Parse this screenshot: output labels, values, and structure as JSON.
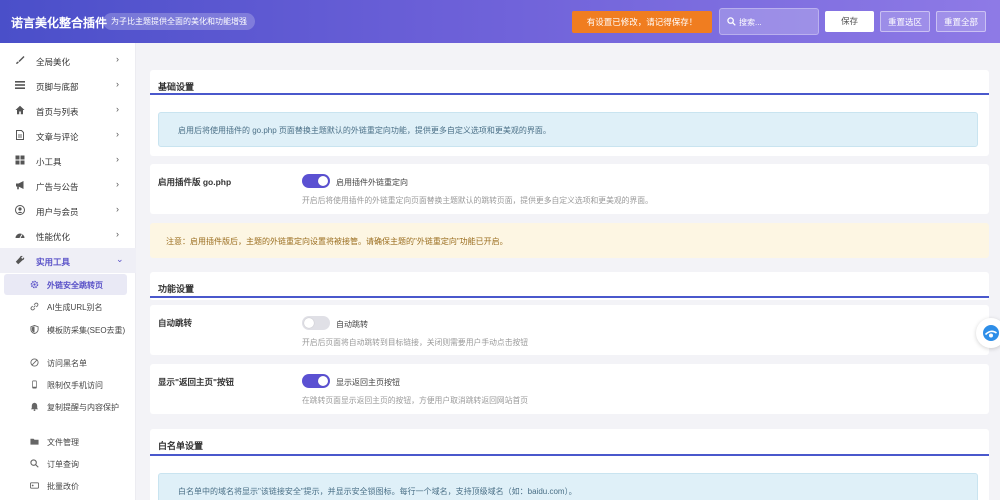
{
  "header": {
    "brand": "诺言美化整合插件",
    "subtitle": "为子比主题提供全面的美化和功能增强",
    "unsaved_notice": "有设置已修改，请记得保存！",
    "search_placeholder": "搜索...",
    "save_label": "保存",
    "reset_section_label": "重置选区",
    "reset_all_label": "重置全部"
  },
  "sidebar": {
    "items": [
      {
        "label": "全局美化",
        "icon": "brush-icon"
      },
      {
        "label": "页脚与底部",
        "icon": "list-icon"
      },
      {
        "label": "首页与列表",
        "icon": "home-icon"
      },
      {
        "label": "文章与评论",
        "icon": "document-icon"
      },
      {
        "label": "小工具",
        "icon": "grid-icon"
      },
      {
        "label": "广告与公告",
        "icon": "megaphone-icon"
      },
      {
        "label": "用户与会员",
        "icon": "user-icon"
      },
      {
        "label": "性能优化",
        "icon": "dashboard-icon"
      },
      {
        "label": "实用工具",
        "icon": "wrench-icon"
      }
    ],
    "active_chevron": "⌄",
    "collapsed_chevron": "›",
    "sub_items": [
      {
        "label": "外链安全跳转页",
        "icon": "gear-icon"
      },
      {
        "label": "AI生成URL别名",
        "icon": "link-icon"
      },
      {
        "label": "模板防采集(SEO去重)",
        "icon": "shield-icon"
      },
      {
        "label": "访问黑名单",
        "icon": "ban-icon"
      },
      {
        "label": "限制仅手机访问",
        "icon": "phone-icon"
      },
      {
        "label": "复制提醒与内容保护",
        "icon": "bell-icon"
      },
      {
        "label": "文件管理",
        "icon": "folder-icon"
      },
      {
        "label": "订单查询",
        "icon": "search-icon"
      },
      {
        "label": "批量改价",
        "icon": "tag-icon"
      }
    ]
  },
  "main": {
    "basic": {
      "title": "基础设置",
      "info": "启用后将使用插件的 go.php 页面替换主题默认的外链重定向功能，提供更多自定义选项和更美观的界面。",
      "option_title": "启用插件版 go.php",
      "toggle_label": "启用插件外链重定向",
      "toggle_on": true,
      "desc": "开启后将使用插件的外链重定向页面替换主题默认的跳转页面，提供更多自定义选项和更美观的界面。",
      "warning": "注意：启用插件版后，主题的外链重定向设置将被接管。请确保主题的\"外链重定向\"功能已开启。"
    },
    "function": {
      "title": "功能设置",
      "auto_title": "自动跳转",
      "auto_toggle_label": "自动跳转",
      "auto_toggle_on": false,
      "auto_desc": "开启后页面将自动跳转到目标链接，关闭则需要用户手动点击按钮",
      "home_title": "显示\"返回主页\"按钮",
      "home_toggle_label": "显示返回主页按钮",
      "home_toggle_on": true,
      "home_desc": "在跳转页面显示返回主页的按钮，方便用户取消跳转返回网站首页"
    },
    "whitelist": {
      "title": "白名单设置",
      "info": "白名单中的域名将显示\"该链接安全\"提示，并显示安全锁图标。每行一个域名，支持顶级域名（如：baidu.com）。"
    }
  }
}
